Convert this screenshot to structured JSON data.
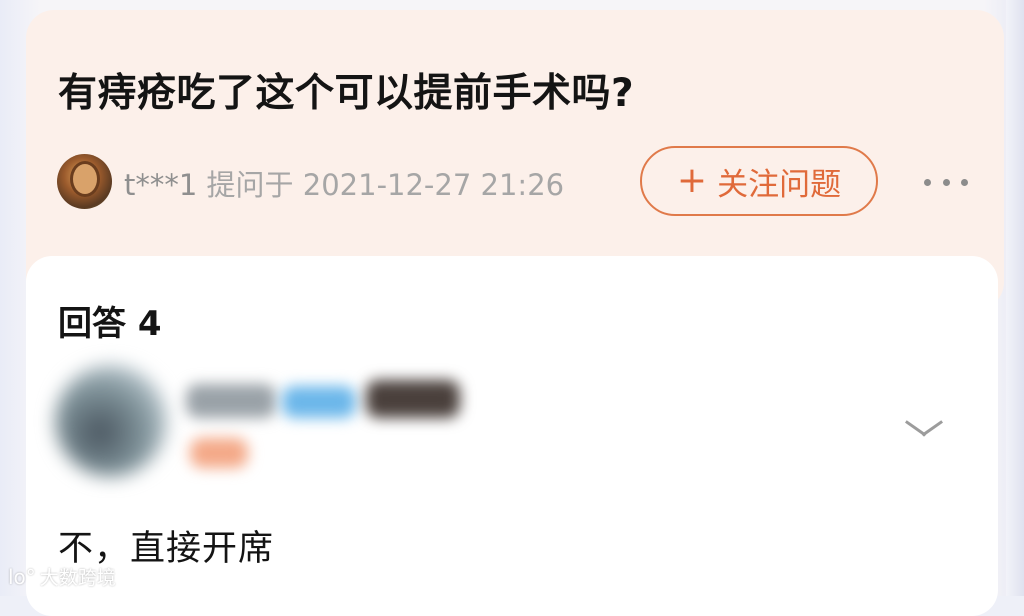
{
  "question": {
    "title": "有痔疮吃了这个可以提前手术吗?",
    "asker_name": "t***1",
    "asked_at": "提问于 2021-12-27 21:26",
    "follow_label": "关注问题",
    "follow_icon": "+",
    "more_icon": "ellipsis-icon"
  },
  "answers": {
    "heading": "回答 4",
    "first_answer": {
      "text": "不，直接开席",
      "expand_icon": "chevron-down-icon"
    }
  },
  "watermark": {
    "logo": "lo°",
    "text": "大数跨境"
  },
  "colors": {
    "question_card_bg": "#fcf0ea",
    "accent": "#e06a3a",
    "meta_text": "#a6a6a6"
  }
}
